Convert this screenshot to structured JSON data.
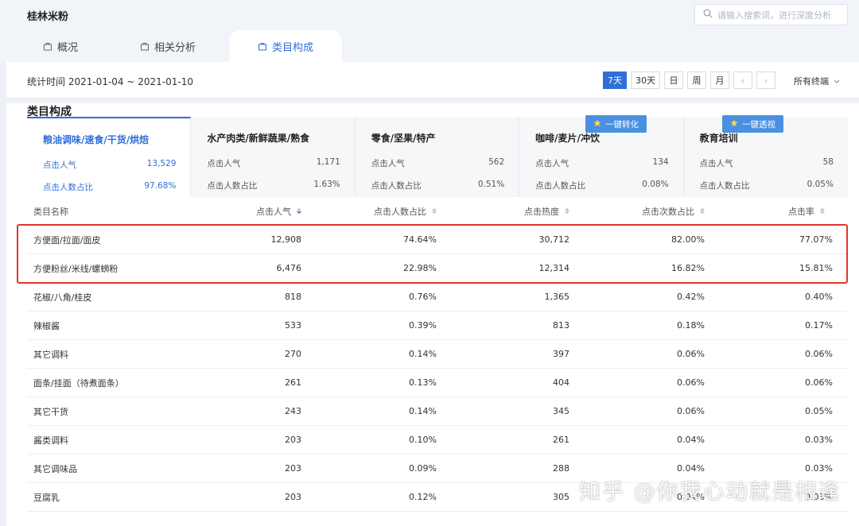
{
  "app": {
    "title": "桂林米粉"
  },
  "search": {
    "placeholder": "请输入搜索词，进行深度分析"
  },
  "tabs": [
    {
      "label": "概况",
      "icon": "bag-icon",
      "active": false
    },
    {
      "label": "相关分析",
      "icon": "bag-icon",
      "active": false
    },
    {
      "label": "类目构成",
      "icon": "bag-icon",
      "active": true
    }
  ],
  "filters": {
    "stat_time": "统计时间 2021-01-04 ~ 2021-01-10",
    "ranges": [
      "7天",
      "30天",
      "日",
      "周",
      "月"
    ],
    "active_range": "7天",
    "prev": "‹",
    "next": "›",
    "terminal": "所有终端"
  },
  "section": {
    "title": "类目构成"
  },
  "cards": [
    {
      "name": "粮油调味/速食/干货/烘焙",
      "metric1_label": "点击人气",
      "metric1_value": "13,529",
      "metric2_label": "点击人数占比",
      "metric2_value": "97.68%"
    },
    {
      "name": "水产肉类/新鲜蔬果/熟食",
      "metric1_label": "点击人气",
      "metric1_value": "1,171",
      "metric2_label": "点击人数占比",
      "metric2_value": "1.63%"
    },
    {
      "name": "零食/坚果/特产",
      "metric1_label": "点击人气",
      "metric1_value": "562",
      "metric2_label": "点击人数占比",
      "metric2_value": "0.51%"
    },
    {
      "name": "咖啡/麦片/冲饮",
      "metric1_label": "点击人气",
      "metric1_value": "134",
      "metric2_label": "点击人数占比",
      "metric2_value": "0.08%"
    },
    {
      "name": "教育培训",
      "metric1_label": "点击人气",
      "metric1_value": "58",
      "metric2_label": "点击人数占比",
      "metric2_value": "0.05%"
    }
  ],
  "floating_buttons": {
    "convert": "一键转化",
    "perspective": "一键透视"
  },
  "table": {
    "headers": [
      "类目名称",
      "点击人气",
      "点击人数占比",
      "点击热度",
      "点击次数占比",
      "点击率"
    ],
    "rows": [
      [
        "方便面/拉面/面皮",
        "12,908",
        "74.64%",
        "30,712",
        "82.00%",
        "77.07%"
      ],
      [
        "方便粉丝/米线/螺蛳粉",
        "6,476",
        "22.98%",
        "12,314",
        "16.82%",
        "15.81%"
      ],
      [
        "花椒/八角/桂皮",
        "818",
        "0.76%",
        "1,365",
        "0.42%",
        "0.40%"
      ],
      [
        "辣椒酱",
        "533",
        "0.39%",
        "813",
        "0.18%",
        "0.17%"
      ],
      [
        "其它调料",
        "270",
        "0.14%",
        "397",
        "0.06%",
        "0.06%"
      ],
      [
        "面条/挂面（待煮面条）",
        "261",
        "0.13%",
        "404",
        "0.06%",
        "0.06%"
      ],
      [
        "其它干货",
        "243",
        "0.14%",
        "345",
        "0.06%",
        "0.05%"
      ],
      [
        "酱类调料",
        "203",
        "0.10%",
        "261",
        "0.04%",
        "0.03%"
      ],
      [
        "其它调味品",
        "203",
        "0.09%",
        "288",
        "0.04%",
        "0.03%"
      ],
      [
        "豆腐乳",
        "203",
        "0.12%",
        "305",
        "0.04%",
        "0.03%"
      ]
    ]
  },
  "watermark": "知乎 @你我心动就是相逢",
  "colors": {
    "accent": "#2f6fd6",
    "highlight": "#e0352b",
    "button": "#4a90e2"
  }
}
